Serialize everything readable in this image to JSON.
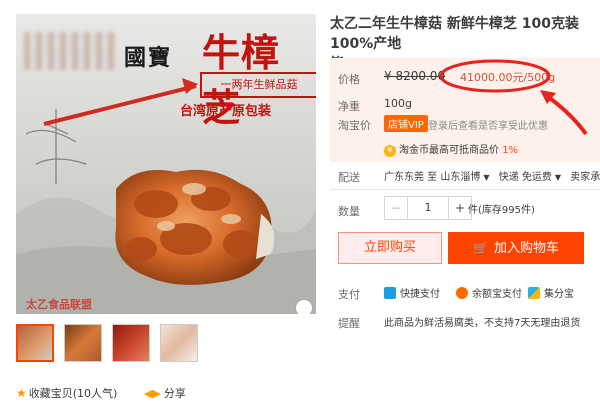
{
  "image": {
    "brand_small": "國寶",
    "brand_big": "牛樟芝",
    "tag": "一两年生鲜品菇",
    "origin": "台湾原产原包装",
    "watermark": "太乙食品联盟"
  },
  "gallery": {
    "thumbnails": [
      "thumb-1",
      "thumb-2",
      "thumb-3",
      "thumb-4"
    ]
  },
  "footer": {
    "collect_label": "收藏宝贝",
    "collect_count": "(10人气)",
    "share_label": "分享"
  },
  "product": {
    "title_line1": "太乙二年生牛樟菇 新鲜牛樟芝 100克装 100%产地",
    "title_line2": "皆"
  },
  "price": {
    "label": "价格",
    "original": "¥ 8200.00",
    "promo": "41000.00元/500g"
  },
  "net": {
    "label": "净重",
    "value": "100g"
  },
  "tb_price": {
    "label": "淘宝价",
    "vip": "店铺VIP",
    "tip": "登录后查看是否享受此优惠"
  },
  "coin": {
    "text": "淘金币最高可抵商品价",
    "percent": "1%"
  },
  "shipping": {
    "label": "配送",
    "from": "广东东莞 至",
    "to": "山东淄博",
    "method": "快递 免运费",
    "promise": "卖家承诺"
  },
  "quantity": {
    "label": "数量",
    "minus": "−",
    "value": "1",
    "plus": "+",
    "stock": "件(库存995件)"
  },
  "actions": {
    "buy_now": "立即购买",
    "add_to_cart": "加入购物车"
  },
  "payment": {
    "label": "支付",
    "methods": [
      "快捷支付",
      "余额宝支付",
      "集分宝"
    ]
  },
  "remind": {
    "label": "提醒",
    "text": "此商品为鲜活易腐类，不支持7天无理由退货"
  },
  "colors": {
    "accent": "#ff4400",
    "annotation": "#e8231d",
    "price_panel": "#fef0ea"
  }
}
